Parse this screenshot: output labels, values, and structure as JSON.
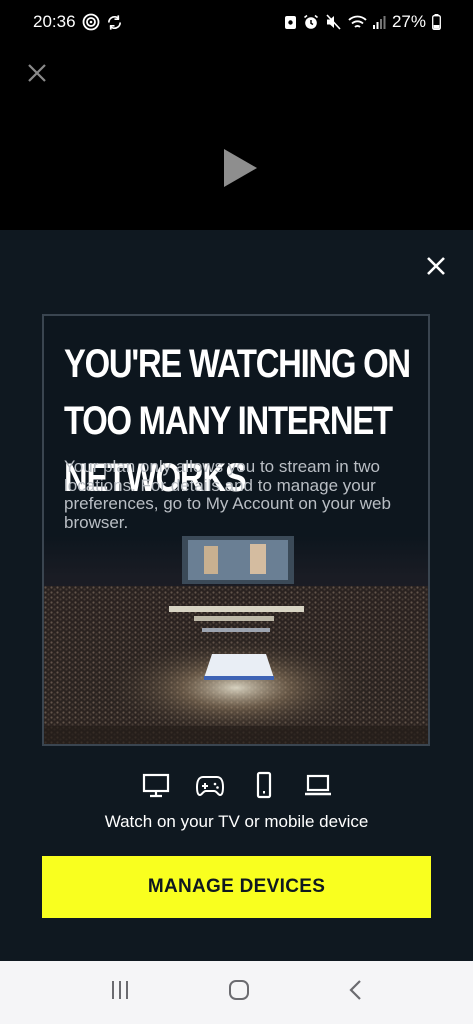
{
  "status_bar": {
    "time": "20:36",
    "battery": "27%"
  },
  "video": {
    "close_icon": "close-icon",
    "play_icon": "play-icon"
  },
  "modal": {
    "close_icon": "close-icon",
    "title": "YOU'RE WATCHING ON TOO MANY INTERNET NETWORKS",
    "body": "Your plan only allows you to stream in two locations. For details and to manage your preferences, go to My Account on your web browser.",
    "devices": [
      "tv-icon",
      "gamepad-icon",
      "phone-icon",
      "laptop-icon"
    ],
    "watch_text": "Watch on your TV or mobile device",
    "manage_button": "MANAGE DEVICES",
    "colors": {
      "background": "#0f1820",
      "accent": "#f9ff1f"
    }
  },
  "nav_bar": {
    "recents": "recents-icon",
    "home": "home-icon",
    "back": "back-icon"
  }
}
